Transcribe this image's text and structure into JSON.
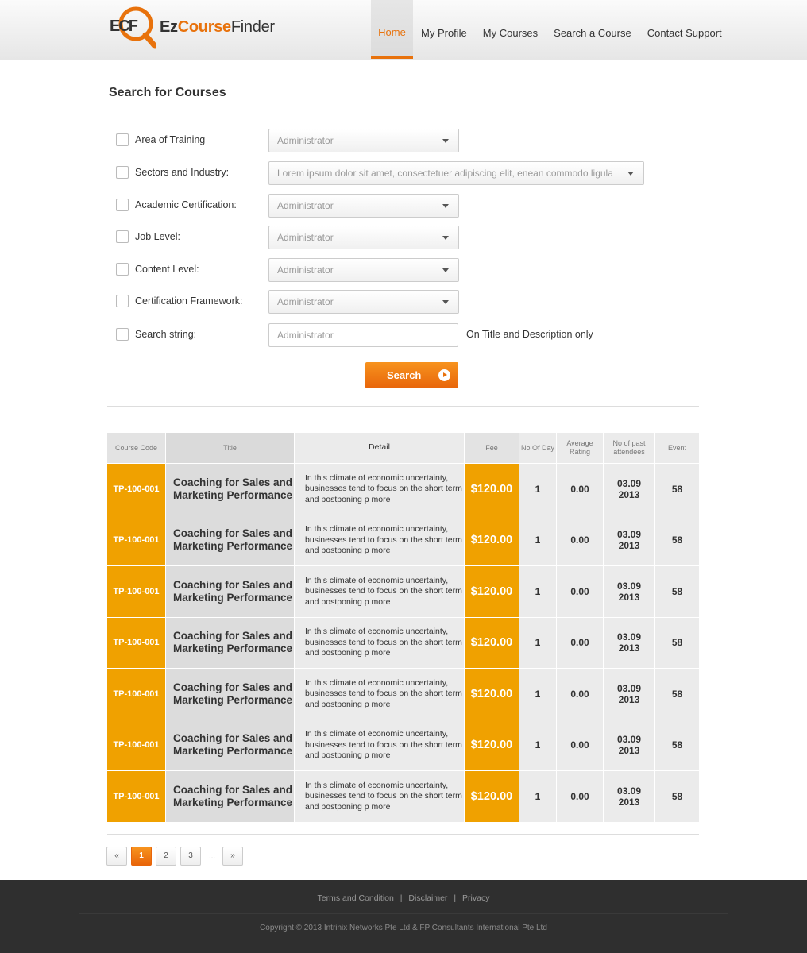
{
  "brand": {
    "mark": "ECF",
    "name_part1": "Ez",
    "name_part2": "Course",
    "name_part3": "Finder",
    "accent_color": "#e8720c"
  },
  "nav": [
    {
      "label": "Home",
      "active": true
    },
    {
      "label": "My Profile",
      "active": false
    },
    {
      "label": "My Courses",
      "active": false
    },
    {
      "label": "Search a Course",
      "active": false
    },
    {
      "label": "Contact Support",
      "active": false
    }
  ],
  "search": {
    "title": "Search for Courses",
    "fields": [
      {
        "label": "Area of Training",
        "value": "Administrator"
      },
      {
        "label": "Sectors and Industry:",
        "value": "Lorem ipsum dolor sit amet, consectetuer adipiscing elit, enean commodo ligula"
      },
      {
        "label": "Academic Certification:",
        "value": "Administrator"
      },
      {
        "label": "Job Level:",
        "value": "Administrator"
      },
      {
        "label": "Content Level:",
        "value": "Administrator"
      },
      {
        "label": "Certification Framework:",
        "value": "Administrator"
      }
    ],
    "string_label": "Search string:",
    "string_placeholder": "Administrator",
    "string_hint": "On Title and Description only",
    "button_label": "Search"
  },
  "table": {
    "headers": {
      "code": "Course Code",
      "title": "Title",
      "detail": "Detail",
      "fee": "Fee",
      "days": "No Of Day",
      "rating": "Average Rating",
      "past": "No of past attendees",
      "event": "Event"
    },
    "rows": [
      {
        "code": "TP-100-001",
        "title": "Coaching for Sales and Marketing Performance",
        "detail": "In this climate of economic uncertainty, businesses tend to focus on the short term and postponing p more",
        "fee": "$120.00",
        "days": "1",
        "rating": "0.00",
        "past_line1": "03.09",
        "past_line2": "2013",
        "event": "58"
      },
      {
        "code": "TP-100-001",
        "title": "Coaching for Sales and Marketing Performance",
        "detail": "In this climate of economic uncertainty, businesses tend to focus on the short term and postponing p more",
        "fee": "$120.00",
        "days": "1",
        "rating": "0.00",
        "past_line1": "03.09",
        "past_line2": "2013",
        "event": "58"
      },
      {
        "code": "TP-100-001",
        "title": "Coaching for Sales and Marketing Performance",
        "detail": "In this climate of economic uncertainty, businesses tend to focus on the short term and postponing p more",
        "fee": "$120.00",
        "days": "1",
        "rating": "0.00",
        "past_line1": "03.09",
        "past_line2": "2013",
        "event": "58"
      },
      {
        "code": "TP-100-001",
        "title": "Coaching for Sales and Marketing Performance",
        "detail": "In this climate of economic uncertainty, businesses tend to focus on the short term and postponing p more",
        "fee": "$120.00",
        "days": "1",
        "rating": "0.00",
        "past_line1": "03.09",
        "past_line2": "2013",
        "event": "58"
      },
      {
        "code": "TP-100-001",
        "title": "Coaching for Sales and Marketing Performance",
        "detail": "In this climate of economic uncertainty, businesses tend to focus on the short term and postponing p more",
        "fee": "$120.00",
        "days": "1",
        "rating": "0.00",
        "past_line1": "03.09",
        "past_line2": "2013",
        "event": "58"
      },
      {
        "code": "TP-100-001",
        "title": "Coaching for Sales and Marketing Performance",
        "detail": "In this climate of economic uncertainty, businesses tend to focus on the short term and postponing p more",
        "fee": "$120.00",
        "days": "1",
        "rating": "0.00",
        "past_line1": "03.09",
        "past_line2": "2013",
        "event": "58"
      },
      {
        "code": "TP-100-001",
        "title": "Coaching for Sales and Marketing Performance",
        "detail": "In this climate of economic uncertainty, businesses tend to focus on the short term and postponing p more",
        "fee": "$120.00",
        "days": "1",
        "rating": "0.00",
        "past_line1": "03.09",
        "past_line2": "2013",
        "event": "58"
      }
    ]
  },
  "pagination": {
    "prev": "«",
    "pages": [
      "1",
      "2",
      "3"
    ],
    "current": "1",
    "ellipsis": "...",
    "next": "»"
  },
  "footer": {
    "links": [
      "Terms and Condition",
      "Disclaimer",
      "Privacy"
    ],
    "separator": "|",
    "copyright": "Copyright © 2013 Intrinix Networks Pte Ltd & FP Consultants International Pte Ltd"
  }
}
